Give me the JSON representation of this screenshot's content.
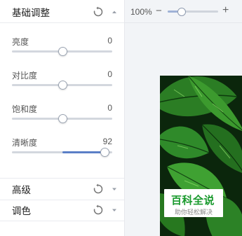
{
  "basic": {
    "title": "基础调整",
    "sliders": [
      {
        "label": "亮度",
        "value": "0",
        "fraction": 0.5
      },
      {
        "label": "对比度",
        "value": "0",
        "fraction": 0.5
      },
      {
        "label": "饱和度",
        "value": "0",
        "fraction": 0.5
      },
      {
        "label": "清晰度",
        "value": "92",
        "fraction": 0.92
      }
    ]
  },
  "advanced": {
    "title": "高级"
  },
  "color": {
    "title": "调色"
  },
  "toolbar": {
    "zoom_label": "100%",
    "zoom_minus": "−",
    "zoom_plus": "+",
    "zoom_fraction": 0.27
  },
  "watermark": {
    "title": "百科全说",
    "subtitle": "助你轻松解决"
  },
  "colors": {
    "accent": "#5b7fc7",
    "leaf_green": "#2f8a2a",
    "brand_green": "#1a9a2e"
  },
  "icons": [
    "reset-icon",
    "caret-up-icon",
    "caret-down-icon"
  ]
}
